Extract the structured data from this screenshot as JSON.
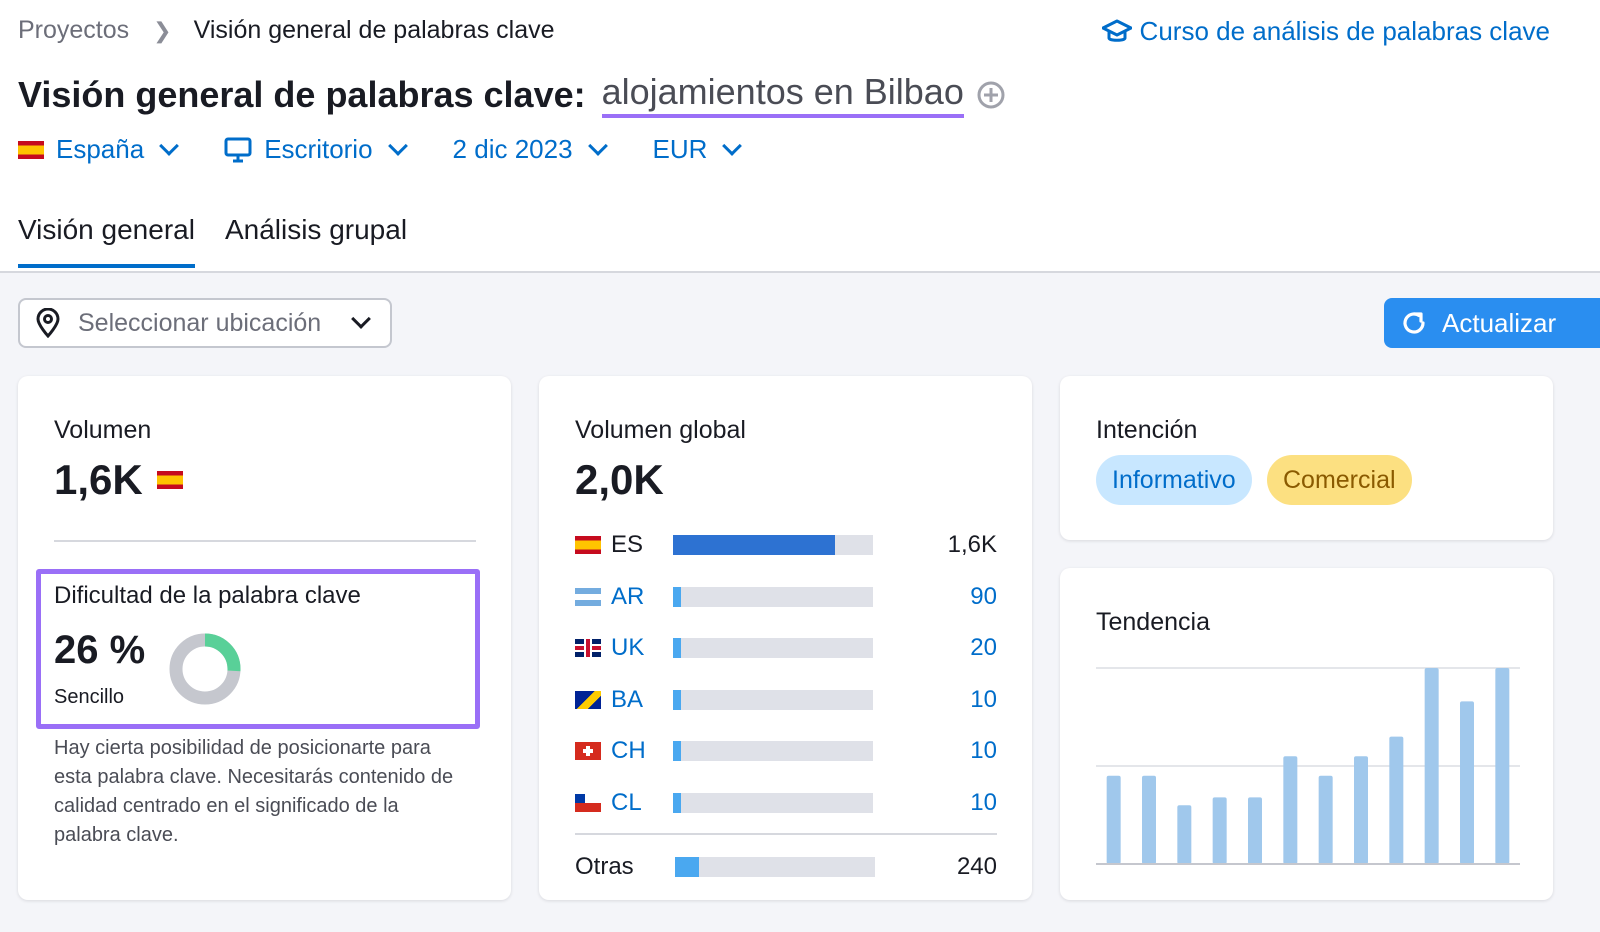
{
  "breadcrumb": {
    "root": "Proyectos",
    "current": "Visión general de palabras clave"
  },
  "course_link": "Curso de análisis de palabras clave",
  "title": {
    "prefix": "Visión general de palabras clave:",
    "keyword": "alojamientos en Bilbao"
  },
  "filters": {
    "country": "España",
    "device": "Escritorio",
    "date": "2 dic 2023",
    "currency": "EUR"
  },
  "tabs": [
    {
      "label": "Visión general",
      "active": true
    },
    {
      "label": "Análisis grupal",
      "active": false
    }
  ],
  "location_select": {
    "placeholder": "Seleccionar ubicación"
  },
  "refresh_button": "Actualizar",
  "volume_card": {
    "label": "Volumen",
    "value": "1,6K",
    "kd_label": "Dificultad de la palabra clave",
    "kd_value": "26 %",
    "kd_percent": 26,
    "kd_level": "Sencillo",
    "kd_description": "Hay cierta posibilidad de posicionarte para esta palabra clave. Necesitarás contenido de calidad centrado en el significado de la palabra clave."
  },
  "global_card": {
    "label": "Volumen global",
    "value": "2,0K",
    "countries": [
      {
        "code": "ES",
        "value": "1,6K",
        "share": 0.81,
        "flag": "flag-es"
      },
      {
        "code": "AR",
        "value": "90",
        "share": 0.04,
        "flag": "flag-ar"
      },
      {
        "code": "UK",
        "value": "20",
        "share": 0.02,
        "flag": "flag-uk"
      },
      {
        "code": "BA",
        "value": "10",
        "share": 0.02,
        "flag": "flag-ba"
      },
      {
        "code": "CH",
        "value": "10",
        "share": 0.02,
        "flag": "flag-ch"
      },
      {
        "code": "CL",
        "value": "10",
        "share": 0.02,
        "flag": "flag-cl"
      }
    ],
    "others": {
      "label": "Otras",
      "value": "240",
      "share": 0.12
    }
  },
  "intent_card": {
    "label": "Intención",
    "badges": [
      "Informativo",
      "Comercial"
    ]
  },
  "trend_card": {
    "label": "Tendencia"
  },
  "colors": {
    "accent": "#006dca",
    "button": "#2a8ef0",
    "highlight": "#9a6ff7",
    "bar_es": "#2d72d2",
    "bar_other": "#4aa8f0",
    "trend_bar": "#a0c8ec",
    "kd_green": "#59d098",
    "kd_gray": "#c5c7ce",
    "informativo_bg": "#c8e7ff",
    "comercial_bg": "#fce081"
  },
  "chart_data": {
    "type": "bar",
    "title": "Tendencia",
    "categories": [
      "1",
      "2",
      "3",
      "4",
      "5",
      "6",
      "7",
      "8",
      "9",
      "10",
      "11",
      "12"
    ],
    "values": [
      0.45,
      0.45,
      0.3,
      0.34,
      0.34,
      0.55,
      0.45,
      0.55,
      0.65,
      1.0,
      0.83,
      1.0
    ],
    "ylim": [
      0,
      1
    ],
    "grid": true,
    "xlabel": "",
    "ylabel": ""
  }
}
